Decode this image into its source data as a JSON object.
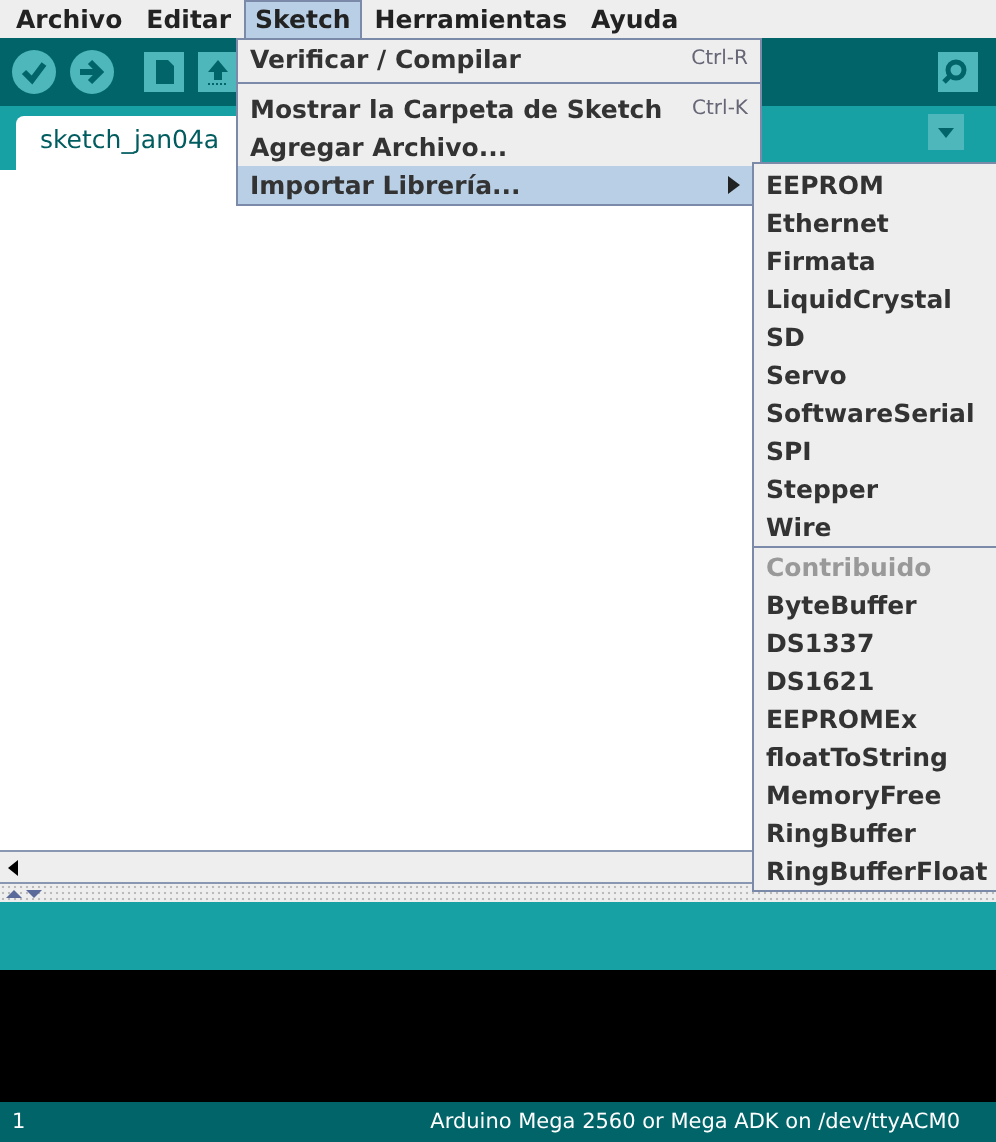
{
  "menubar": [
    {
      "label": "Archivo",
      "selected": false
    },
    {
      "label": "Editar",
      "selected": false
    },
    {
      "label": "Sketch",
      "selected": true
    },
    {
      "label": "Herramientas",
      "selected": false
    },
    {
      "label": "Ayuda",
      "selected": false
    }
  ],
  "sketch_menu": {
    "groups": [
      [
        {
          "label": "Verificar / Compilar",
          "shortcut": "Ctrl-R",
          "selected": false,
          "submenu": false
        }
      ],
      [
        {
          "label": "Mostrar la Carpeta de Sketch",
          "shortcut": "Ctrl-K",
          "selected": false,
          "submenu": false
        },
        {
          "label": "Agregar Archivo...",
          "selected": false,
          "submenu": false
        },
        {
          "label": "Importar Librería...",
          "selected": true,
          "submenu": true
        }
      ]
    ]
  },
  "library_submenu": {
    "groups": [
      {
        "items": [
          "EEPROM",
          "Ethernet",
          "Firmata",
          "LiquidCrystal",
          "SD",
          "Servo",
          "SoftwareSerial",
          "SPI",
          "Stepper",
          "Wire"
        ]
      },
      {
        "header": "Contribuido",
        "items": [
          "ByteBuffer",
          "DS1337",
          "DS1621",
          "EEPROMEx",
          "floatToString",
          "MemoryFree",
          "RingBuffer",
          "RingBufferFloat"
        ]
      }
    ]
  },
  "tabs": [
    {
      "label": "sketch_jan04a",
      "selected": true
    }
  ],
  "status_bar": {
    "line": "1",
    "board": "Arduino Mega 2560 or Mega ADK on /dev/ttyACM0"
  }
}
